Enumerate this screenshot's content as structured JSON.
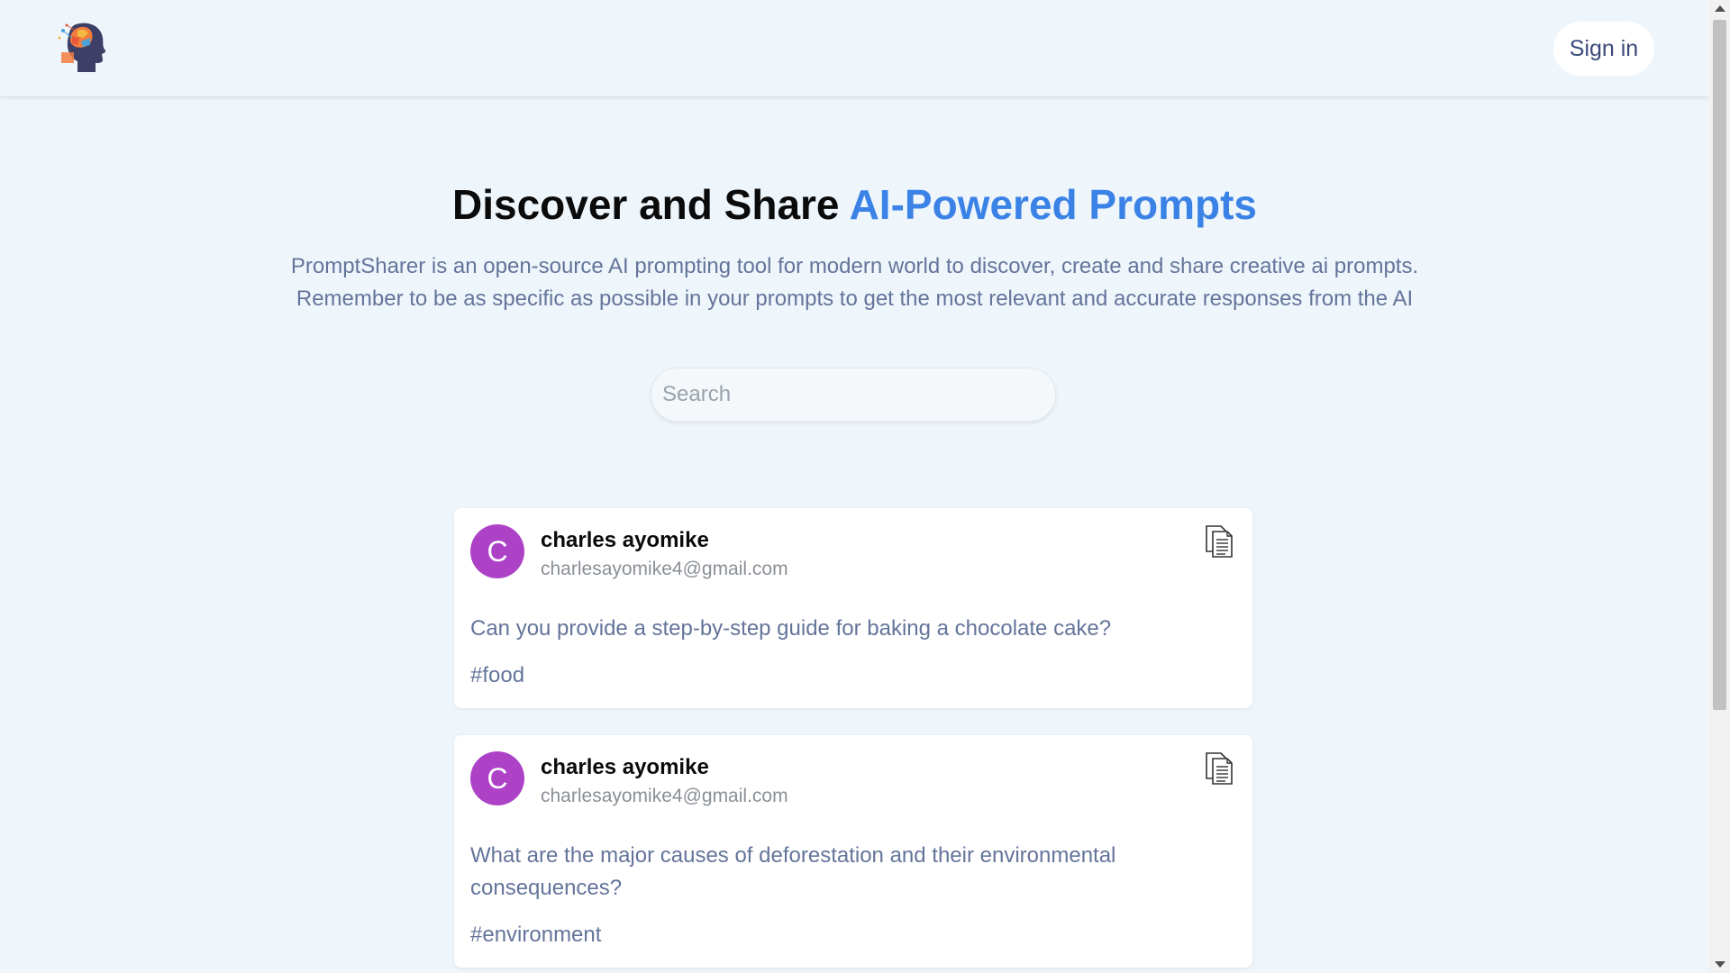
{
  "header": {
    "logo_icon": "brain-head-logo-icon",
    "signin_label": "Sign in"
  },
  "hero": {
    "title_main": "Discover and Share ",
    "title_accent": "AI-Powered Prompts",
    "description_line1": "PromptSharer is an open-source AI prompting tool for modern world to discover, create and share creative ai prompts.",
    "description_line2": "Remember to be as specific as possible in your prompts to get the most relevant and accurate responses from the AI"
  },
  "search": {
    "placeholder": "Search",
    "value": ""
  },
  "posts": [
    {
      "avatar_letter": "C",
      "name": "charles ayomike",
      "email": "charlesayomike4@gmail.com",
      "prompt": "Can you provide a step-by-step guide for baking a chocolate cake?",
      "tag": "#food",
      "copy_icon": "copy-icon"
    },
    {
      "avatar_letter": "C",
      "name": "charles ayomike",
      "email": "charlesayomike4@gmail.com",
      "prompt": "What are the major causes of deforestation and their environmental consequences?",
      "tag": "#environment",
      "copy_icon": "copy-icon"
    }
  ],
  "colors": {
    "background": "#eef6fc",
    "accent": "#3b82e6",
    "avatar": "#ad42c7",
    "muted_text": "#64749a"
  }
}
